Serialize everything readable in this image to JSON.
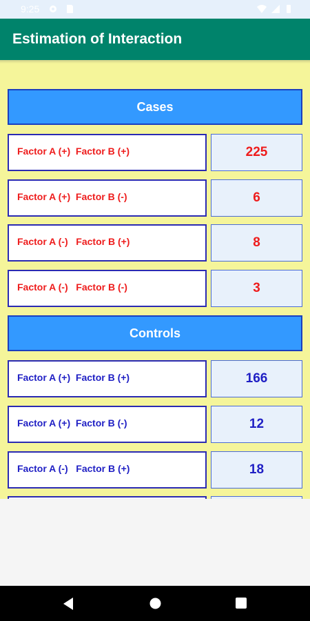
{
  "status_bar": {
    "time": "9:25"
  },
  "app_bar": {
    "title": "Estimation of Interaction"
  },
  "cases": {
    "header": "Cases",
    "rows": [
      {
        "label": "Factor A (+)  Factor B (+)",
        "value": "225"
      },
      {
        "label": "Factor A (+)  Factor B (-)",
        "value": "6"
      },
      {
        "label": "Factor A (-)   Factor B (+)",
        "value": "8"
      },
      {
        "label": "Factor A (-)   Factor B (-)",
        "value": "3"
      }
    ]
  },
  "controls": {
    "header": "Controls",
    "rows": [
      {
        "label": "Factor A (+)  Factor B (+)",
        "value": "166"
      },
      {
        "label": "Factor A (+)  Factor B (-)",
        "value": "12"
      },
      {
        "label": "Factor A (-)   Factor B (+)",
        "value": "18"
      }
    ]
  },
  "colors": {
    "app_bar": "#00836b",
    "content_bg": "#f5f59a",
    "section_header": "#3399ff",
    "cases_text": "#ee1c1c",
    "controls_text": "#1f1fc4"
  },
  "icons": [
    "gear-icon",
    "sd-card-icon",
    "wifi-icon",
    "battery-icon",
    "back-icon",
    "home-icon",
    "recents-icon"
  ]
}
